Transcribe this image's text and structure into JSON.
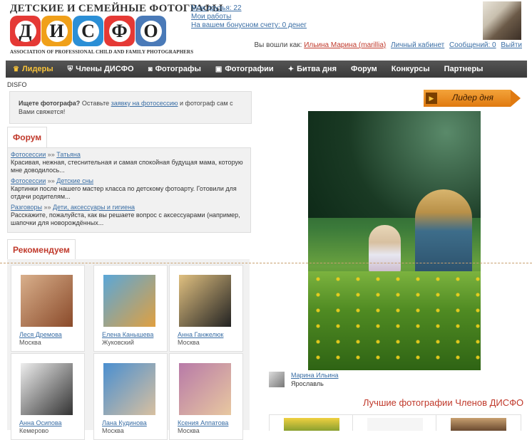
{
  "header": {
    "site_title": "ДЕТСКИЕ И СЕМЕЙНЫЕ ФОТОГРАФЫ",
    "logo_letters": [
      {
        "char": "Д",
        "color": "#e53935"
      },
      {
        "char": "И",
        "color": "#f0a019"
      },
      {
        "char": "С",
        "color": "#2b8fd6"
      },
      {
        "char": "Ф",
        "color": "#e53935"
      },
      {
        "char": "О",
        "color": "#4a7ab8"
      }
    ],
    "association": "ASSOCIATION OF PROFESSIONAL CHILD AND FAMILY PHOTOGRAPHERS",
    "links": {
      "friends": "Мои друзья: 22",
      "works": "Мои работы",
      "bonus": "На вашем бонусном счету: 0 денег"
    },
    "login": {
      "prefix": "Вы вошли как:",
      "user": "Ильина Марина (marillia)",
      "cabinet": "Личный кабинет",
      "messages": "Сообщений: 0",
      "logout": "Выйти"
    }
  },
  "nav": [
    {
      "label": "Лидеры",
      "icon": "crown-icon",
      "glyph": "♛",
      "active": true
    },
    {
      "label": "Члены ДИСФО",
      "icon": "shield-icon",
      "glyph": "⛨",
      "active": false
    },
    {
      "label": "Фотографы",
      "icon": "camera-icon",
      "glyph": "◙",
      "active": false
    },
    {
      "label": "Фотографии",
      "icon": "photos-icon",
      "glyph": "▣",
      "active": false
    },
    {
      "label": "Битва дня",
      "icon": "battle-icon",
      "glyph": "✦",
      "active": false
    },
    {
      "label": "Форум",
      "icon": "",
      "glyph": "",
      "active": false
    },
    {
      "label": "Конкурсы",
      "icon": "",
      "glyph": "",
      "active": false
    },
    {
      "label": "Партнеры",
      "icon": "",
      "glyph": "",
      "active": false
    }
  ],
  "breadcrumb": "DISFO",
  "search_box": {
    "bold": "Ищете фотографа?",
    "before": "Оставьте",
    "link": "заявку на фотосессию",
    "after": "и фотограф сам с Вами свяжется!"
  },
  "forum": {
    "tab": "Форум",
    "entries": [
      {
        "category": "Фотосессии",
        "sep": "»»",
        "topic": "Татьяна",
        "text": "Красивая, нежная, стеснительная и самая спокойная будущая мама, которую мне доводилось..."
      },
      {
        "category": "Фотосессии",
        "sep": "»»",
        "topic": "Детские сны",
        "text": "Картинки после нашего мастер класса по детскому фотоарту. Готовили для отдачи родителям..."
      },
      {
        "category": "Разговоры",
        "sep": "»»",
        "topic": "Дети, аксессуары и гигиена",
        "text": "Расскажите, пожалуйста, как вы решаете вопрос с аксессуарами (например, шапочки для новорождённых..."
      }
    ]
  },
  "recommended": {
    "tab": "Рекомендуем",
    "cards": [
      {
        "name": "Леся Дремова",
        "city": "Москва",
        "tone": [
          "#d9b08c",
          "#8a4a2a"
        ]
      },
      {
        "name": "Елена Канышева",
        "city": "Жуковский",
        "tone": [
          "#5aa7d8",
          "#e0a040"
        ]
      },
      {
        "name": "Анна Ганжелюк",
        "city": "Москва",
        "tone": [
          "#e0c080",
          "#222222"
        ]
      },
      {
        "name": "Анна Осипова",
        "city": "Кемерово",
        "tone": [
          "#eeeeee",
          "#333333"
        ]
      },
      {
        "name": "Лана Кудинова",
        "city": "Москва",
        "tone": [
          "#4a8fd0",
          "#d8c0a0"
        ]
      },
      {
        "name": "Ксения Аппатова",
        "city": "Москва",
        "tone": [
          "#b87aa8",
          "#e8c8a0"
        ]
      }
    ]
  },
  "leader": {
    "label": "Лидер дня",
    "author": "Марина Ильина",
    "city": "Ярославль"
  },
  "best_title": "Лучшие фотографии Членов ДИСФО",
  "colors": {
    "accent_red": "#c0392b",
    "link_blue": "#3a6ea5",
    "nav_active": "#f7c33b",
    "leader_orange": "#e07a10"
  }
}
